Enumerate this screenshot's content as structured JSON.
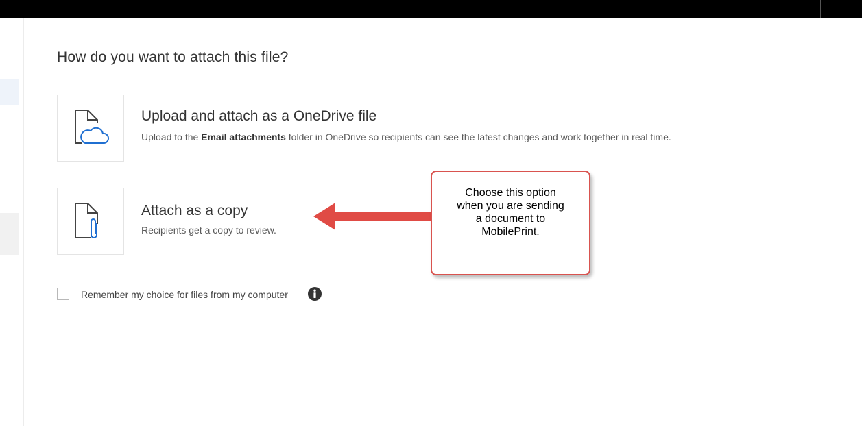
{
  "dialog": {
    "title": "How do you want to attach this file?"
  },
  "options": [
    {
      "title": "Upload and attach as a OneDrive file",
      "desc_before": "Upload to the ",
      "desc_bold": "Email attachments",
      "desc_after": " folder in OneDrive so recipients can see the latest changes and work together in real time.",
      "icon": "file-cloud-icon"
    },
    {
      "title": "Attach as a copy",
      "desc": "Recipients get a copy to review.",
      "icon": "file-paperclip-icon"
    }
  ],
  "remember": {
    "label": "Remember my choice for files from my computer",
    "checked": false,
    "icon": "info-icon"
  },
  "callout": {
    "lines": [
      "Choose this option",
      "when you are sending",
      "a document to",
      "MobilePrint."
    ],
    "border_color": "#d9534f",
    "arrow_color": "#e04b45"
  },
  "colors": {
    "topbar": "#000000",
    "icon_accent": "#1f6fd1",
    "icon_stroke": "#444444"
  }
}
